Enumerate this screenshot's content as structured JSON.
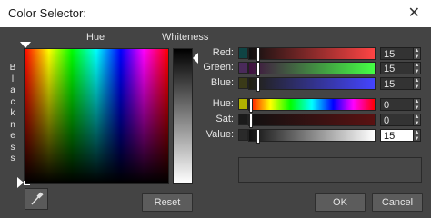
{
  "window": {
    "title": "Color Selector:",
    "close_glyph": "✕"
  },
  "labels": {
    "hue": "Hue",
    "whiteness": "Whiteness",
    "blackness": "Blackness"
  },
  "rows": [
    {
      "id": "red",
      "label": "Red:",
      "value": "15",
      "swatch": "#0f4444",
      "fill_from": "#0f1010",
      "fill_to": "#ff4444",
      "level": 0.06
    },
    {
      "id": "green",
      "label": "Green:",
      "value": "15",
      "swatch": "#4a2a5a",
      "fill_from": "#400f40",
      "fill_to": "#44ff44",
      "level": 0.06
    },
    {
      "id": "blue",
      "label": "Blue:",
      "value": "15",
      "swatch": "#3a3a18",
      "fill_from": "#202010",
      "fill_to": "#4444ff",
      "level": 0.06
    },
    {
      "id": "hue",
      "label": "Hue:",
      "value": "0",
      "swatch": "#b0b000",
      "level": 0.0
    },
    {
      "id": "sat",
      "label": "Sat:",
      "value": "0",
      "swatch": "#1a1a1a",
      "fill_from": "#111111",
      "fill_to": "#5a1212",
      "level": 0.0
    },
    {
      "id": "value",
      "label": "Value:",
      "value": "15",
      "swatch": "#2a2a2a",
      "fill_from": "#0f0f0f",
      "fill_to": "#ffffff",
      "level": 0.06
    }
  ],
  "buttons": {
    "reset": "Reset",
    "ok": "OK",
    "cancel": "Cancel"
  },
  "icons": {
    "eyedropper": "eyedropper-icon",
    "spin_up": "▲",
    "spin_down": "▼"
  }
}
